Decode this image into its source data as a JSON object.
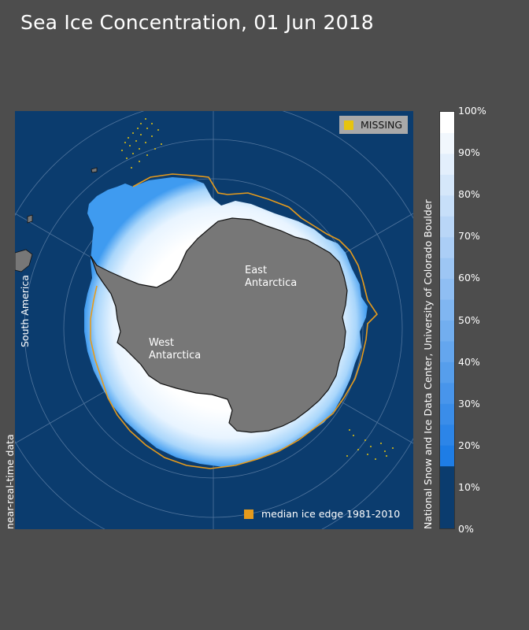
{
  "title": "Sea Ice Concentration, 01 Jun 2018",
  "map": {
    "labels": {
      "east": [
        "East",
        "Antarctica"
      ],
      "west": [
        "West",
        "Antarctica"
      ],
      "south_america": "South America"
    },
    "missing_label": "MISSING",
    "median_label": "median ice edge 1981-2010",
    "near_real_time": "near-real-time data",
    "colors": {
      "ocean": "#0b3c6e",
      "land": "#777777",
      "ice_high": "#ffffff",
      "ice_low": "#1f7fe0",
      "median_edge": "#e69b1c",
      "missing": "#e6c40e"
    }
  },
  "colorbar": {
    "credit": "National Snow and Ice Data Center, University of Colorado Boulder",
    "ticks": [
      "100%",
      "90%",
      "80%",
      "70%",
      "60%",
      "50%",
      "40%",
      "30%",
      "20%",
      "10%",
      "0%"
    ],
    "bottom_color": "#0b3c6e",
    "threshold_percent": 15
  }
}
